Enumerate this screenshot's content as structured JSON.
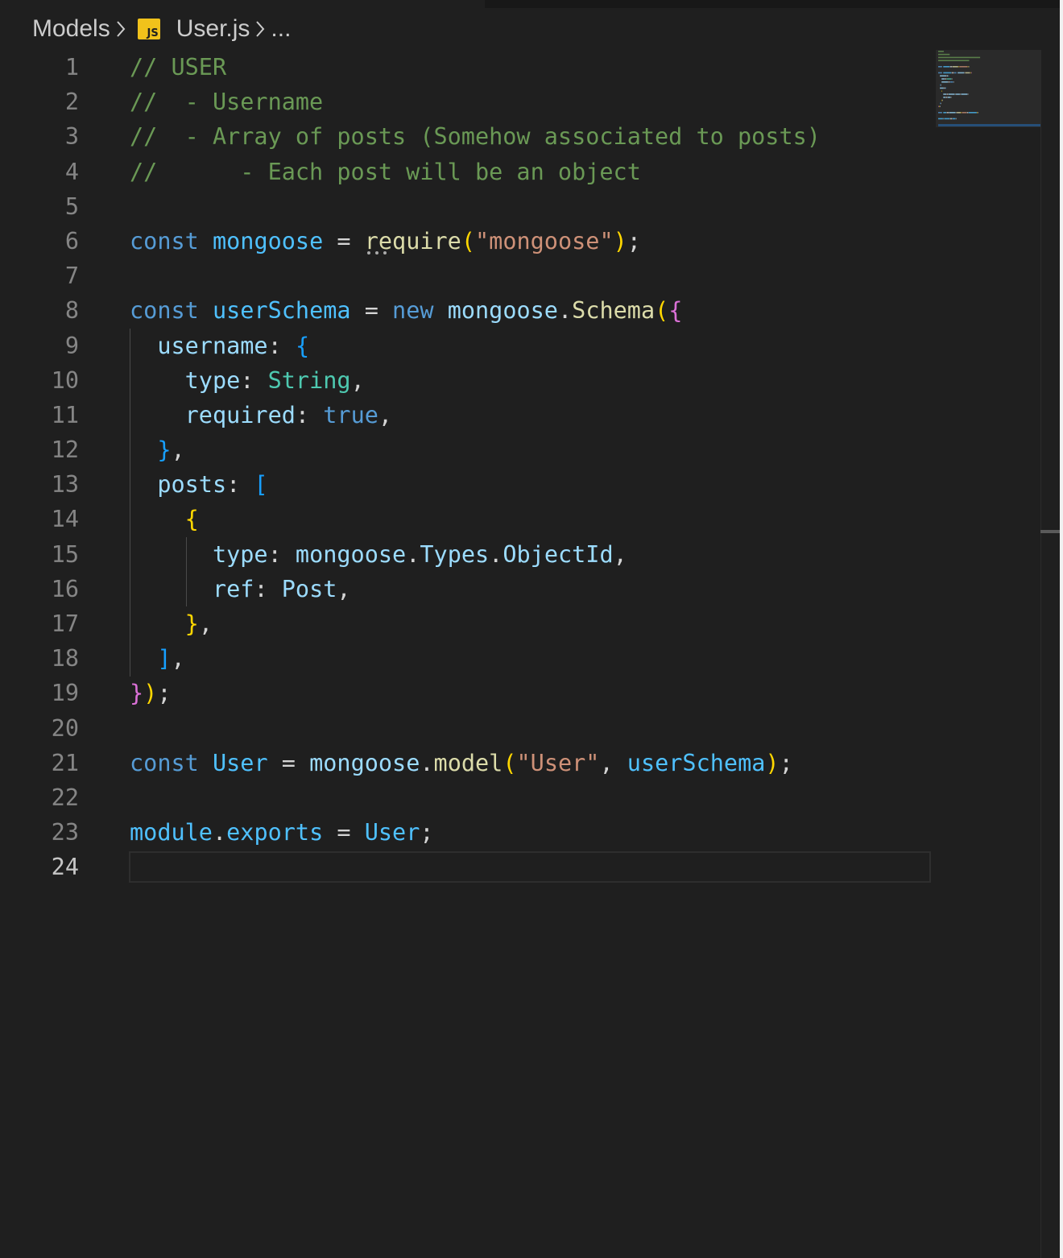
{
  "breadcrumb": {
    "folder": "Models",
    "file_icon": "JS",
    "file": "User.js",
    "ellipsis": "..."
  },
  "editor": {
    "current_line": 24,
    "lines": [
      {
        "n": "1",
        "tokens": [
          {
            "c": "cm",
            "t": "// USER"
          }
        ]
      },
      {
        "n": "2",
        "tokens": [
          {
            "c": "cm",
            "t": "//  - Username"
          }
        ]
      },
      {
        "n": "3",
        "tokens": [
          {
            "c": "cm",
            "t": "//  - Array of posts (Somehow associated to posts)"
          }
        ]
      },
      {
        "n": "4",
        "tokens": [
          {
            "c": "cm",
            "t": "//      - Each post will be an object"
          }
        ]
      },
      {
        "n": "5",
        "tokens": []
      },
      {
        "n": "6",
        "tokens": [
          {
            "c": "kw",
            "t": "const"
          },
          {
            "c": "punc",
            "t": " "
          },
          {
            "c": "var",
            "t": "mongoose"
          },
          {
            "c": "punc",
            "t": " = "
          },
          {
            "c": "fn",
            "t": "require"
          },
          {
            "c": "b1",
            "t": "("
          },
          {
            "c": "str",
            "t": "\"mongoose\""
          },
          {
            "c": "b1",
            "t": ")"
          },
          {
            "c": "punc",
            "t": ";"
          }
        ]
      },
      {
        "n": "7",
        "tokens": []
      },
      {
        "n": "8",
        "tokens": [
          {
            "c": "kw",
            "t": "const"
          },
          {
            "c": "punc",
            "t": " "
          },
          {
            "c": "var",
            "t": "userSchema"
          },
          {
            "c": "punc",
            "t": " = "
          },
          {
            "c": "kw",
            "t": "new"
          },
          {
            "c": "punc",
            "t": " "
          },
          {
            "c": "prop",
            "t": "mongoose"
          },
          {
            "c": "punc",
            "t": "."
          },
          {
            "c": "fn",
            "t": "Schema"
          },
          {
            "c": "b1",
            "t": "("
          },
          {
            "c": "b2",
            "t": "{"
          }
        ]
      },
      {
        "n": "9",
        "tokens": [
          {
            "c": "punc",
            "t": "  "
          },
          {
            "c": "prop",
            "t": "username"
          },
          {
            "c": "punc",
            "t": ": "
          },
          {
            "c": "b3",
            "t": "{"
          }
        ]
      },
      {
        "n": "10",
        "tokens": [
          {
            "c": "punc",
            "t": "    "
          },
          {
            "c": "prop",
            "t": "type"
          },
          {
            "c": "punc",
            "t": ": "
          },
          {
            "c": "type",
            "t": "String"
          },
          {
            "c": "punc",
            "t": ","
          }
        ]
      },
      {
        "n": "11",
        "tokens": [
          {
            "c": "punc",
            "t": "    "
          },
          {
            "c": "prop",
            "t": "required"
          },
          {
            "c": "punc",
            "t": ": "
          },
          {
            "c": "kw",
            "t": "true"
          },
          {
            "c": "punc",
            "t": ","
          }
        ]
      },
      {
        "n": "12",
        "tokens": [
          {
            "c": "punc",
            "t": "  "
          },
          {
            "c": "b3",
            "t": "}"
          },
          {
            "c": "punc",
            "t": ","
          }
        ]
      },
      {
        "n": "13",
        "tokens": [
          {
            "c": "punc",
            "t": "  "
          },
          {
            "c": "prop",
            "t": "posts"
          },
          {
            "c": "punc",
            "t": ": "
          },
          {
            "c": "b3",
            "t": "["
          }
        ]
      },
      {
        "n": "14",
        "tokens": [
          {
            "c": "punc",
            "t": "    "
          },
          {
            "c": "b1",
            "t": "{"
          }
        ]
      },
      {
        "n": "15",
        "tokens": [
          {
            "c": "punc",
            "t": "      "
          },
          {
            "c": "prop",
            "t": "type"
          },
          {
            "c": "punc",
            "t": ": "
          },
          {
            "c": "prop",
            "t": "mongoose"
          },
          {
            "c": "punc",
            "t": "."
          },
          {
            "c": "prop",
            "t": "Types"
          },
          {
            "c": "punc",
            "t": "."
          },
          {
            "c": "prop",
            "t": "ObjectId"
          },
          {
            "c": "punc",
            "t": ","
          }
        ]
      },
      {
        "n": "16",
        "tokens": [
          {
            "c": "punc",
            "t": "      "
          },
          {
            "c": "prop",
            "t": "ref"
          },
          {
            "c": "punc",
            "t": ": "
          },
          {
            "c": "prop",
            "t": "Post"
          },
          {
            "c": "punc",
            "t": ","
          }
        ]
      },
      {
        "n": "17",
        "tokens": [
          {
            "c": "punc",
            "t": "    "
          },
          {
            "c": "b1",
            "t": "}"
          },
          {
            "c": "punc",
            "t": ","
          }
        ]
      },
      {
        "n": "18",
        "tokens": [
          {
            "c": "punc",
            "t": "  "
          },
          {
            "c": "b3",
            "t": "]"
          },
          {
            "c": "punc",
            "t": ","
          }
        ]
      },
      {
        "n": "19",
        "tokens": [
          {
            "c": "b2",
            "t": "}"
          },
          {
            "c": "b1",
            "t": ")"
          },
          {
            "c": "punc",
            "t": ";"
          }
        ]
      },
      {
        "n": "20",
        "tokens": []
      },
      {
        "n": "21",
        "tokens": [
          {
            "c": "kw",
            "t": "const"
          },
          {
            "c": "punc",
            "t": " "
          },
          {
            "c": "var",
            "t": "User"
          },
          {
            "c": "punc",
            "t": " = "
          },
          {
            "c": "prop",
            "t": "mongoose"
          },
          {
            "c": "punc",
            "t": "."
          },
          {
            "c": "fn",
            "t": "model"
          },
          {
            "c": "b1",
            "t": "("
          },
          {
            "c": "str",
            "t": "\"User\""
          },
          {
            "c": "punc",
            "t": ", "
          },
          {
            "c": "var",
            "t": "userSchema"
          },
          {
            "c": "b1",
            "t": ")"
          },
          {
            "c": "punc",
            "t": ";"
          }
        ]
      },
      {
        "n": "22",
        "tokens": []
      },
      {
        "n": "23",
        "tokens": [
          {
            "c": "var",
            "t": "module"
          },
          {
            "c": "punc",
            "t": "."
          },
          {
            "c": "var",
            "t": "exports"
          },
          {
            "c": "punc",
            "t": " = "
          },
          {
            "c": "var",
            "t": "User"
          },
          {
            "c": "punc",
            "t": ";"
          }
        ]
      },
      {
        "n": "24",
        "tokens": []
      }
    ]
  },
  "colors": {
    "background": "#1f1f1f",
    "comment": "#6a9955",
    "keyword": "#569cd6",
    "variable": "#4fc1ff",
    "property": "#9cdcfe",
    "function": "#dcdcaa",
    "string": "#ce9178",
    "type": "#4ec9b0",
    "bracket_1": "#ffd700",
    "bracket_2": "#da70d6",
    "bracket_3": "#179fff",
    "js_icon": "#f1c21b"
  }
}
